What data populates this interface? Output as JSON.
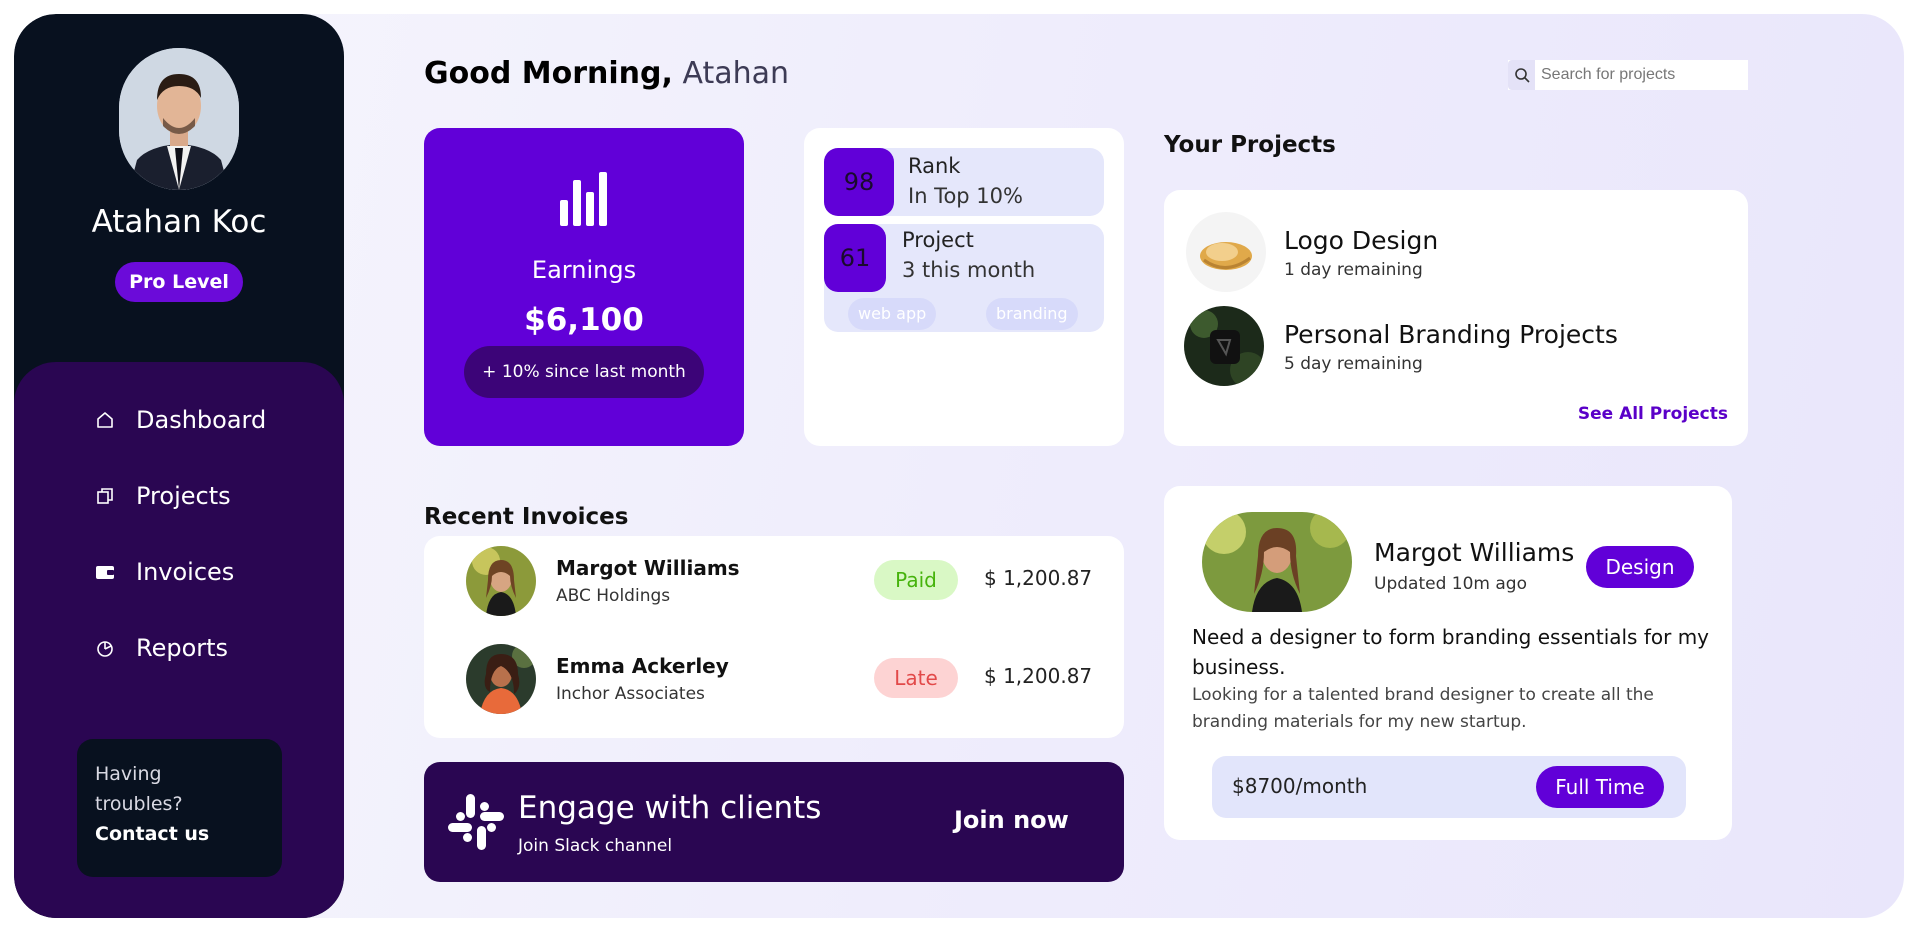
{
  "profile": {
    "name": "Atahan Koc",
    "level": "Pro Level"
  },
  "nav": {
    "items": [
      {
        "label": "Dashboard",
        "icon": "home-icon"
      },
      {
        "label": "Projects",
        "icon": "copy-icon"
      },
      {
        "label": "Invoices",
        "icon": "wallet-icon"
      },
      {
        "label": "Reports",
        "icon": "pie-chart-icon"
      }
    ]
  },
  "help": {
    "line1": "Having",
    "line2": "troubles?",
    "contact": "Contact us"
  },
  "header": {
    "greeting": "Good Morning,",
    "name": "Atahan"
  },
  "search": {
    "placeholder": "Search for projects",
    "value": ""
  },
  "earnings": {
    "label": "Earnings",
    "value": "$6,100",
    "change": "+ 10% since last month"
  },
  "stats": {
    "rank": {
      "number": "98",
      "title": "Rank",
      "subtitle": "In Top 10%"
    },
    "project": {
      "number": "61",
      "title": "Project",
      "subtitle": "3 this month"
    },
    "chips": [
      "web app",
      "branding"
    ]
  },
  "projects": {
    "title": "Your Projects",
    "items": [
      {
        "name": "Logo Design",
        "remaining": "1 day remaining"
      },
      {
        "name": "Personal Branding Projects",
        "remaining": "5 day remaining"
      }
    ],
    "see_all": "See All Projects"
  },
  "invoices": {
    "title": "Recent Invoices",
    "rows": [
      {
        "name": "Margot Williams",
        "company": "ABC Holdings",
        "status": "Paid",
        "amount": "$ 1,200.87"
      },
      {
        "name": "Emma Ackerley",
        "company": "Inchor Associates",
        "status": "Late",
        "amount": "$ 1,200.87"
      }
    ]
  },
  "engage": {
    "title": "Engage with clients",
    "subtitle": "Join Slack channel",
    "cta": "Join now"
  },
  "job": {
    "name": "Margot Williams",
    "updated": "Updated 10m ago",
    "tag": "Design",
    "headline": "Need a designer to form branding essentials for my business.",
    "description": "Looking for a talented brand designer to create all the branding materials for my new startup.",
    "rate": "$8700/month",
    "type": "Full Time"
  },
  "colors": {
    "accent": "#6100d8",
    "sidebar_dark": "#08111f",
    "sidebar_purple": "#2a0652",
    "paid": "#46b30c",
    "late": "#e24949"
  }
}
